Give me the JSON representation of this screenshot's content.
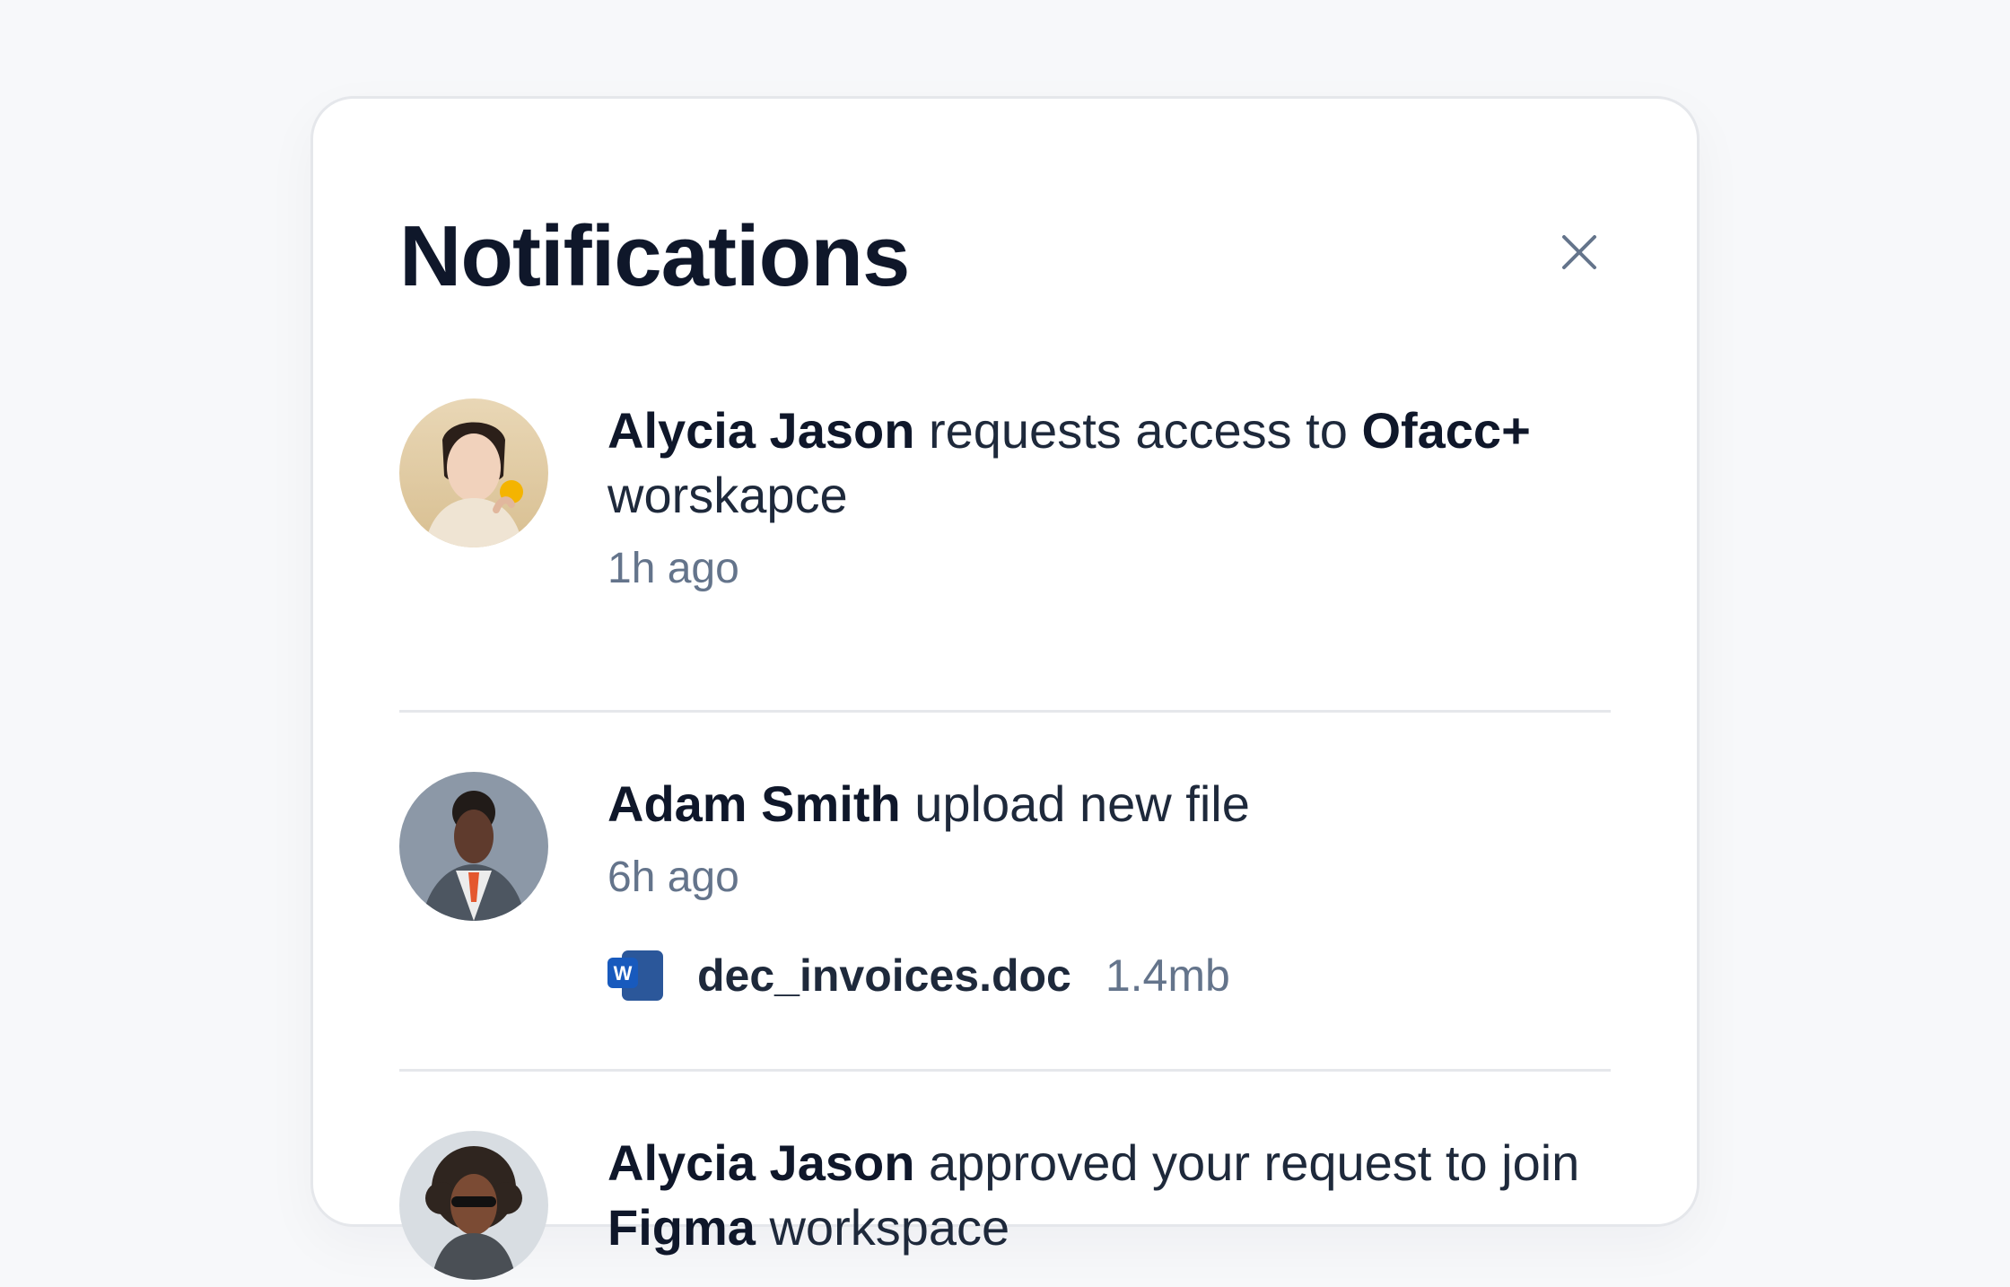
{
  "panel": {
    "title": "Notifications",
    "close_icon": "close-icon"
  },
  "notifications": [
    {
      "actor": "Alycia Jason",
      "action": "requests access to",
      "target": "Ofacc+",
      "suffix": "worskapce",
      "time": "1h ago",
      "avatar_icon": "avatar-woman"
    },
    {
      "actor": "Adam Smith",
      "action": "upload new file",
      "time": "6h ago",
      "avatar_icon": "avatar-man",
      "file": {
        "icon": "word-doc-icon",
        "name": "dec_invoices.doc",
        "size": "1.4mb"
      }
    },
    {
      "actor": "Alycia Jason",
      "action": "approved your request to join",
      "target": "Figma",
      "suffix": "workspace",
      "avatar_icon": "avatar-curly-hair"
    }
  ],
  "colors": {
    "title": "#0f172a",
    "text": "#1e293b",
    "muted": "#64748b",
    "divider": "#e5e7eb",
    "word_blue": "#2b579a"
  }
}
